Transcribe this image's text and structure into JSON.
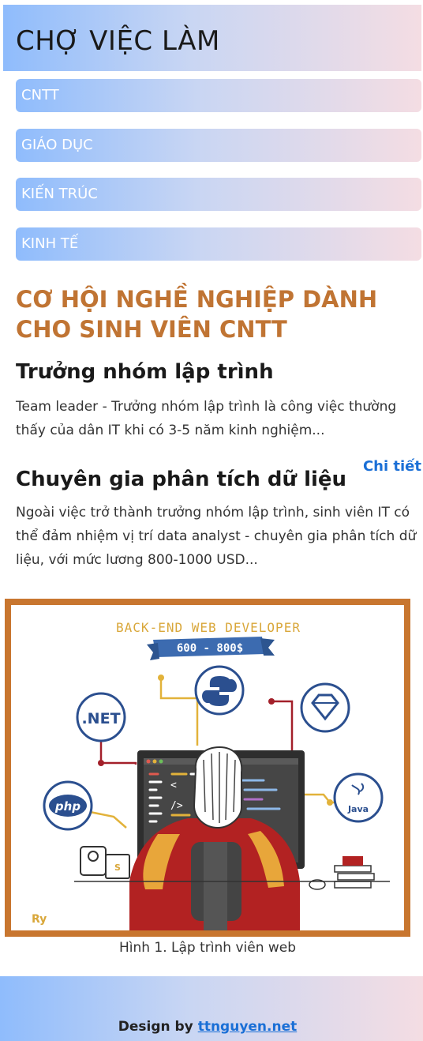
{
  "site": {
    "title": "CHỢ VIỆC LÀM"
  },
  "nav": {
    "items": [
      {
        "label": "CNTT"
      },
      {
        "label": "GIÁO DỤC"
      },
      {
        "label": "KIẾN TRÚC"
      },
      {
        "label": "KINH TẾ"
      }
    ]
  },
  "main": {
    "headline": "CƠ HỘI NGHỀ NGHIỆP DÀNH CHO SINH VIÊN CNTT",
    "articles": [
      {
        "title": "Trưởng nhóm lập trình",
        "summary": "Team leader - Trưởng nhóm lập trình là công việc thường thấy của dân IT khi có 3-5 năm kinh nghiệm..."
      },
      {
        "title": "Chuyên gia phân tích dữ liệu",
        "summary": "Ngoài việc trở thành trưởng nhóm lập trình, sinh viên IT có thể đảm nhiệm vị trí data analyst - chuyên gia phân tích dữ liệu, với mức lương 800-1000 USD..."
      }
    ],
    "detail_link": "Chi tiết"
  },
  "figure": {
    "illustration_title": "BACK-END WEB DEVELOPER",
    "illustration_salary": "600 - 800$",
    "tech_icons": [
      ".NET",
      "php",
      "Java",
      "python-icon",
      "diamond-icon"
    ],
    "signature": "Ry",
    "caption": "Hình 1. Lập trình viên web"
  },
  "footer": {
    "prefix": "Design by",
    "link": "ttnguyen.net"
  },
  "colors": {
    "gradient_start": "#8fbcfc",
    "gradient_end": "#f4dde3",
    "headline": "#c07433",
    "link": "#1a6fd6",
    "figure_border": "#c8762f"
  }
}
